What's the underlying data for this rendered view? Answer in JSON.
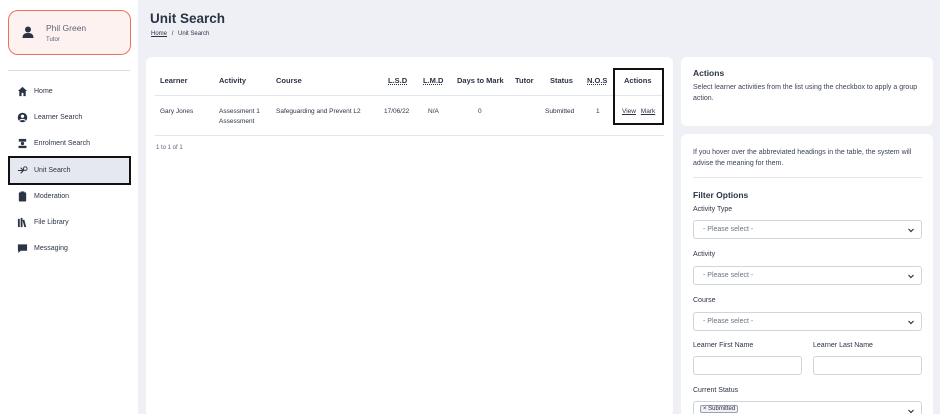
{
  "user": {
    "name": "Phil Green",
    "role": "Tutor"
  },
  "nav": {
    "items": [
      {
        "label": "Home",
        "icon": "home-icon"
      },
      {
        "label": "Learner Search",
        "icon": "user-circle-icon"
      },
      {
        "label": "Enrolment Search",
        "icon": "graduation-icon"
      },
      {
        "label": "Unit Search",
        "icon": "search-unit-icon"
      },
      {
        "label": "Moderation",
        "icon": "clipboard-icon"
      },
      {
        "label": "File Library",
        "icon": "library-icon"
      },
      {
        "label": "Messaging",
        "icon": "chat-icon"
      }
    ],
    "active": "Unit Search"
  },
  "page": {
    "title": "Unit Search",
    "breadcrumb": {
      "home": "Home",
      "separator": "/",
      "current": "Unit Search"
    }
  },
  "table": {
    "headers": {
      "learner": "Learner",
      "activity": "Activity",
      "course": "Course",
      "lsd": "L.S.D",
      "lmd": "L.M.D",
      "days": "Days to Mark",
      "tutor": "Tutor",
      "status": "Status",
      "nos": "N.O.S",
      "actions": "Actions"
    },
    "row": {
      "learner": "Gary Jones",
      "activity_line1": "Assessment 1",
      "activity_line2": "Assessment",
      "course": "Safeguarding and Prevent L2",
      "lsd": "17/06/22",
      "lmd": "N/A",
      "days": "0",
      "tutor": "",
      "status": "Submitted",
      "nos": "1",
      "view": "View",
      "mark": "Mark"
    },
    "pager": "1 to 1 of 1"
  },
  "actions_panel": {
    "title": "Actions",
    "text": "Select learner activities from the list using the checkbox to apply a group action."
  },
  "filters": {
    "hint": "If you hover over the abbreviated headings in the table, the system will advise the meaning for them.",
    "title": "Filter Options",
    "activity_type_label": "Activity Type",
    "activity_label": "Activity",
    "course_label": "Course",
    "placeholder": "- Please select -",
    "first_name_label": "Learner First Name",
    "last_name_label": "Learner Last Name",
    "status_label": "Current Status",
    "status_chip": "× Submitted"
  },
  "colors": {
    "accent_border": "#e8735a",
    "background": "#eef0f6",
    "text": "#2b3445"
  }
}
